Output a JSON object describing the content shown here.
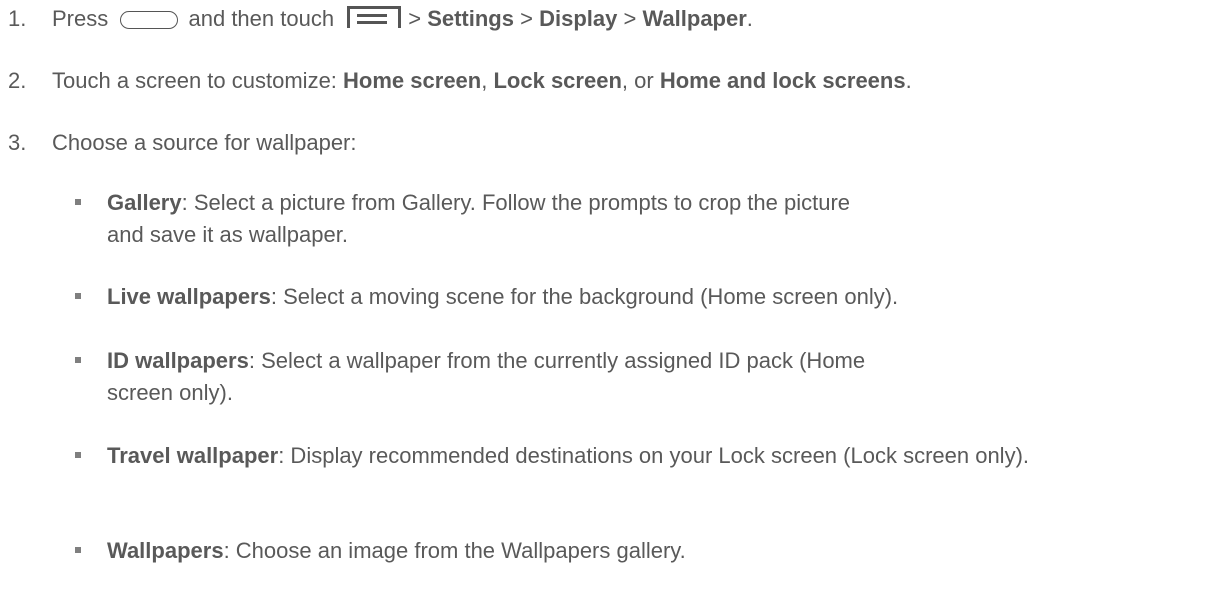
{
  "steps": [
    {
      "num": "1.",
      "press": "Press",
      "then_touch": "and then touch",
      "sep1": ">",
      "settings": "Settings",
      "sep2": ">",
      "display": "Display",
      "sep3": ">",
      "wallpaper": "Wallpaper",
      "end": "."
    },
    {
      "num": "2.",
      "text": "Touch a screen to customize:",
      "opt1": "Home screen",
      "comma1": ",",
      "opt2": "Lock screen",
      "or": ", or",
      "opt3": "Home and lock screens",
      "end": "."
    },
    {
      "num": "3.",
      "text": "Choose a source for wallpaper:"
    }
  ],
  "sources": [
    {
      "name": "Gallery",
      "desc": ": Select a picture from Gallery. Follow the prompts to crop the picture and save it as wallpaper."
    },
    {
      "name": "Live wallpapers",
      "desc": ": Select a moving scene for the background (Home screen only)."
    },
    {
      "name": "ID wallpapers",
      "desc": ": Select a wallpaper from the currently assigned ID pack (Home screen only)."
    },
    {
      "name": "Travel wallpaper",
      "desc": ": Display recommended destinations on your Lock screen (Lock screen only)."
    },
    {
      "name": "Wallpapers",
      "desc": ": Choose an image from the Wallpapers gallery."
    }
  ],
  "icons": {
    "home_key": "home-key-icon",
    "menu_key": "menu-key-icon"
  }
}
